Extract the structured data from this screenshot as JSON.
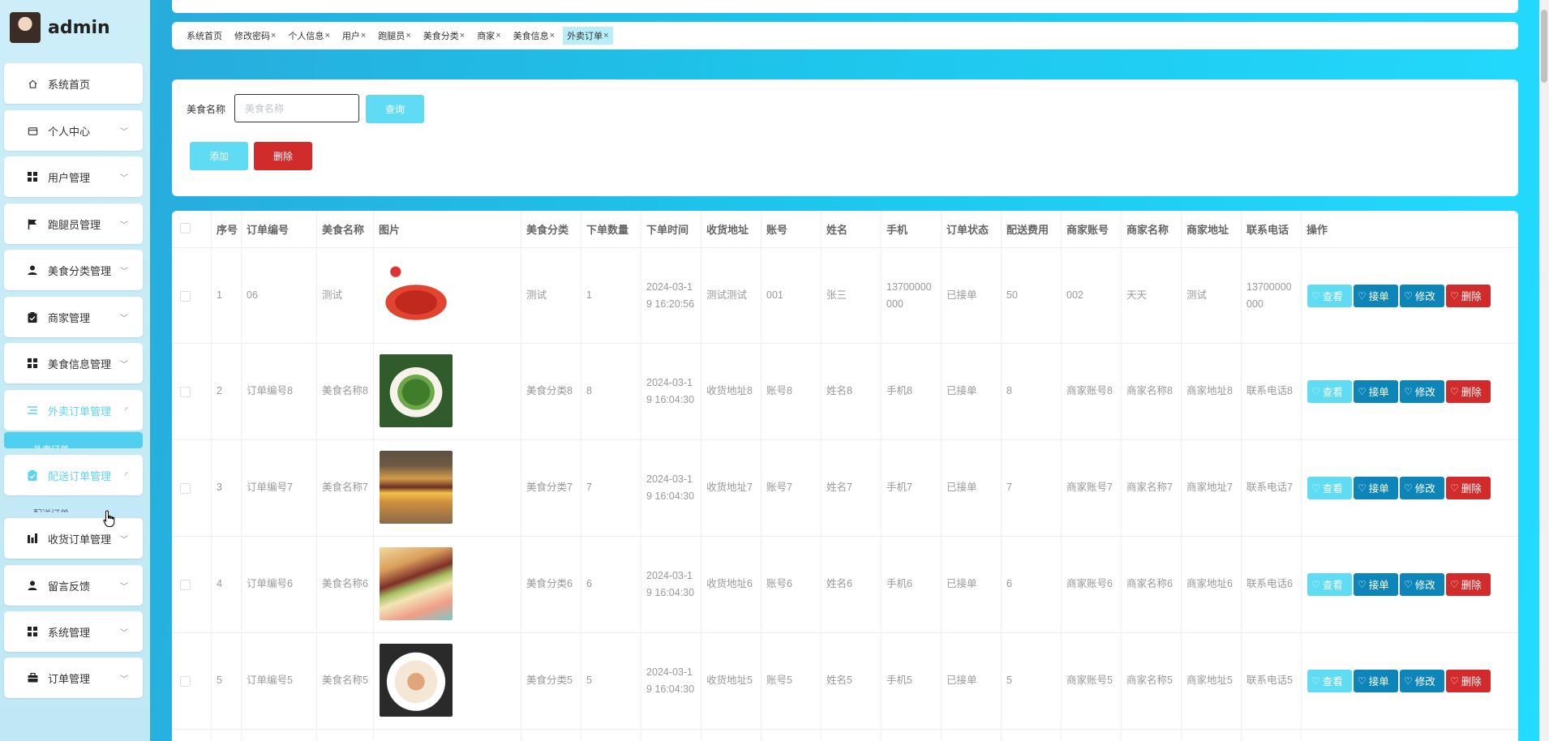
{
  "brand": {
    "username": "admin"
  },
  "sidebar": {
    "items": [
      {
        "label": "系统首页",
        "icon": "home-icon"
      },
      {
        "label": "个人中心",
        "icon": "wallet-icon"
      },
      {
        "label": "用户管理",
        "icon": "grid-icon"
      },
      {
        "label": "跑腿员管理",
        "icon": "flag-icon"
      },
      {
        "label": "美食分类管理",
        "icon": "person-icon"
      },
      {
        "label": "商家管理",
        "icon": "clipboard-icon"
      },
      {
        "label": "美食信息管理",
        "icon": "grid-icon"
      },
      {
        "label": "外卖订单管理",
        "icon": "list-icon"
      },
      {
        "label": "配送订单管理",
        "icon": "clipboard-icon"
      },
      {
        "label": "收货订单管理",
        "icon": "bar-chart-icon"
      },
      {
        "label": "留言反馈",
        "icon": "person-icon"
      },
      {
        "label": "系统管理",
        "icon": "grid-icon"
      },
      {
        "label": "订单管理",
        "icon": "briefcase-icon"
      }
    ],
    "sub_items": {
      "takeout": "外卖订单",
      "delivery": "配送订单"
    }
  },
  "tabs": [
    {
      "label": "系统首页",
      "closable": false
    },
    {
      "label": "修改密码",
      "closable": true
    },
    {
      "label": "个人信息",
      "closable": true
    },
    {
      "label": "用户",
      "closable": true
    },
    {
      "label": "跑腿员",
      "closable": true
    },
    {
      "label": "美食分类",
      "closable": true
    },
    {
      "label": "商家",
      "closable": true
    },
    {
      "label": "美食信息",
      "closable": true
    },
    {
      "label": "外卖订单",
      "closable": true,
      "active": true
    }
  ],
  "tab_close_glyph": "×",
  "search": {
    "label": "美食名称",
    "placeholder": "美食名称",
    "value": "",
    "query_button": "查询"
  },
  "toolbar": {
    "add_label": "添加",
    "delete_label": "删除"
  },
  "table": {
    "headers": [
      "序号",
      "订单编号",
      "美食名称",
      "图片",
      "美食分类",
      "下单数量",
      "下单时间",
      "收货地址",
      "账号",
      "姓名",
      "手机",
      "订单状态",
      "配送费用",
      "商家账号",
      "商家名称",
      "商家地址",
      "联系电话",
      "操作"
    ],
    "rows": [
      {
        "no": "1",
        "order_no": "06",
        "food": "测试",
        "img": "crayfish",
        "category": "测试",
        "qty": "1",
        "time": "2024-03-19 16:20:56",
        "address": "测试测试",
        "account": "001",
        "name": "张三",
        "phone": "13700000000",
        "status": "已接单",
        "fee": "50",
        "m_account": "002",
        "m_name": "天天",
        "m_address": "测试",
        "m_phone": "13700000000"
      },
      {
        "no": "2",
        "order_no": "订单编号8",
        "food": "美食名称8",
        "img": "greens",
        "category": "美食分类8",
        "qty": "8",
        "time": "2024-03-19 16:04:30",
        "address": "收货地址8",
        "account": "账号8",
        "name": "姓名8",
        "phone": "手机8",
        "status": "已接单",
        "fee": "8",
        "m_account": "商家账号8",
        "m_name": "商家名称8",
        "m_address": "商家地址8",
        "m_phone": "联系电话8"
      },
      {
        "no": "3",
        "order_no": "订单编号7",
        "food": "美食名称7",
        "img": "burger",
        "category": "美食分类7",
        "qty": "7",
        "time": "2024-03-19 16:04:30",
        "address": "收货地址7",
        "account": "账号7",
        "name": "姓名7",
        "phone": "手机7",
        "status": "已接单",
        "fee": "7",
        "m_account": "商家账号7",
        "m_name": "商家名称7",
        "m_address": "商家地址7",
        "m_phone": "联系电话7"
      },
      {
        "no": "4",
        "order_no": "订单编号6",
        "food": "美食名称6",
        "img": "sandwich",
        "category": "美食分类6",
        "qty": "6",
        "time": "2024-03-19 16:04:30",
        "address": "收货地址6",
        "account": "账号6",
        "name": "姓名6",
        "phone": "手机6",
        "status": "已接单",
        "fee": "6",
        "m_account": "商家账号6",
        "m_name": "商家名称6",
        "m_address": "商家地址6",
        "m_phone": "联系电话6"
      },
      {
        "no": "5",
        "order_no": "订单编号5",
        "food": "美食名称5",
        "img": "sashimi",
        "category": "美食分类5",
        "qty": "5",
        "time": "2024-03-19 16:04:30",
        "address": "收货地址5",
        "account": "账号5",
        "name": "姓名5",
        "phone": "手机5",
        "status": "已接单",
        "fee": "5",
        "m_account": "商家账号5",
        "m_name": "商家名称5",
        "m_address": "商家地址5",
        "m_phone": "联系电话5"
      }
    ],
    "actions": {
      "view": "查看",
      "take": "接单",
      "edit": "修改",
      "delete": "删除"
    }
  },
  "colors": {
    "accent": "#5fdcf3",
    "primary": "#0d85b8",
    "danger": "#d12b2b"
  }
}
